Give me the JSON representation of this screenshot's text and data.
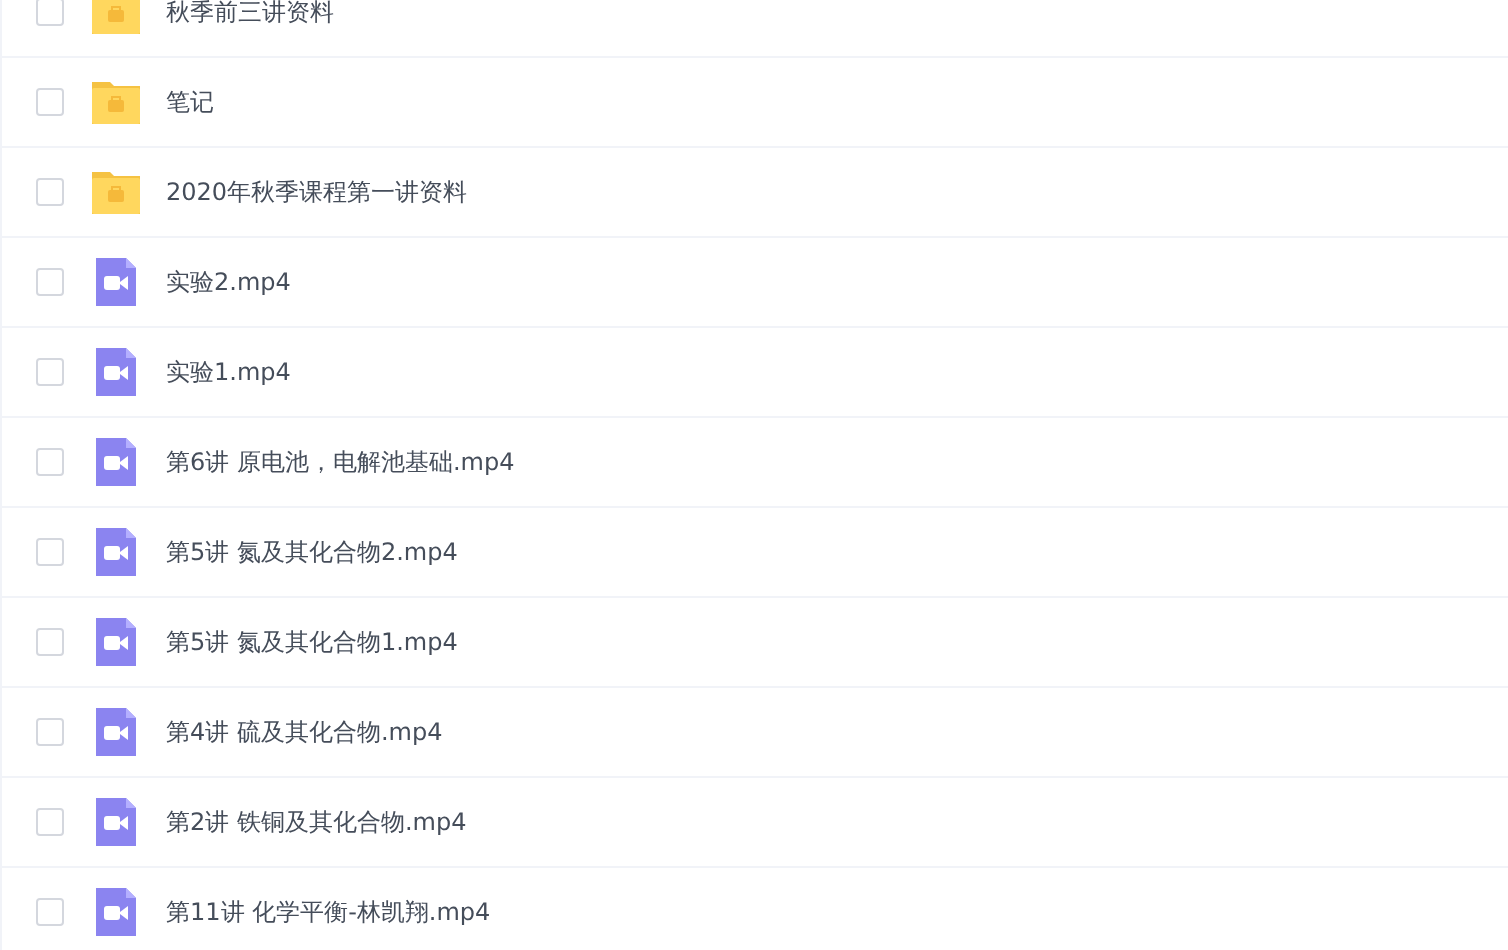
{
  "files": [
    {
      "kind": "folder",
      "name": "秋季前三讲资料",
      "checked": false
    },
    {
      "kind": "folder",
      "name": "笔记",
      "checked": false
    },
    {
      "kind": "folder",
      "name": "2020年秋季课程第一讲资料",
      "checked": false
    },
    {
      "kind": "video",
      "name": "实验2.mp4",
      "checked": false
    },
    {
      "kind": "video",
      "name": "实验1.mp4",
      "checked": false
    },
    {
      "kind": "video",
      "name": "第6讲 原电池，电解池基础.mp4",
      "checked": false
    },
    {
      "kind": "video",
      "name": "第5讲 氮及其化合物2.mp4",
      "checked": false
    },
    {
      "kind": "video",
      "name": "第5讲 氮及其化合物1.mp4",
      "checked": false
    },
    {
      "kind": "video",
      "name": "第4讲 硫及其化合物.mp4",
      "checked": false
    },
    {
      "kind": "video",
      "name": "第2讲 铁铜及其化合物.mp4",
      "checked": false
    },
    {
      "kind": "video",
      "name": "第11讲 化学平衡-林凯翔.mp4",
      "checked": false
    }
  ]
}
